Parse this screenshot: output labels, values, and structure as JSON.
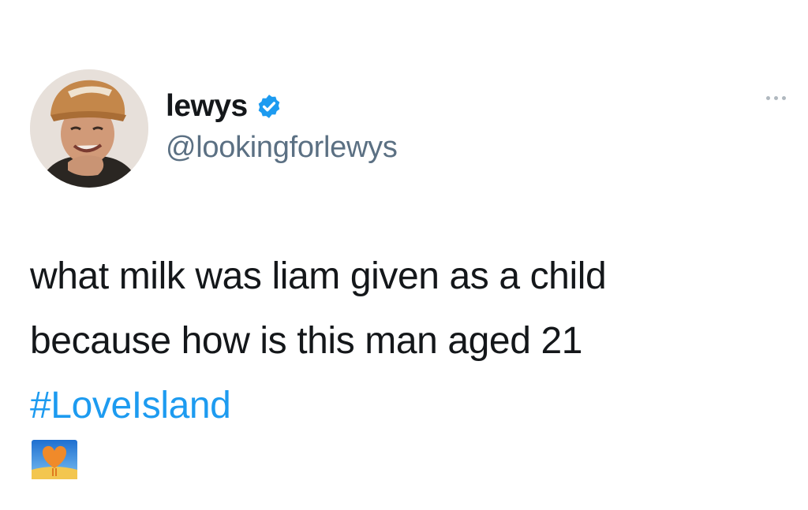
{
  "tweet": {
    "author": {
      "display_name": "lewys",
      "handle": "@lookingforlewys",
      "verified": true,
      "avatar_icon": "profile-photo-cap"
    },
    "menu_icon": "more-dots-icon",
    "text_lines": [
      "what milk was liam given as a child",
      "because how is this man aged 21"
    ],
    "hashtag": "#LoveIsland",
    "hashflag_icon": "love-island-heart-icon"
  },
  "colors": {
    "text": "#14171a",
    "handle": "#5b7083",
    "link": "#1d9bf0",
    "verified": "#1d9bf0",
    "background": "#ffffff"
  }
}
